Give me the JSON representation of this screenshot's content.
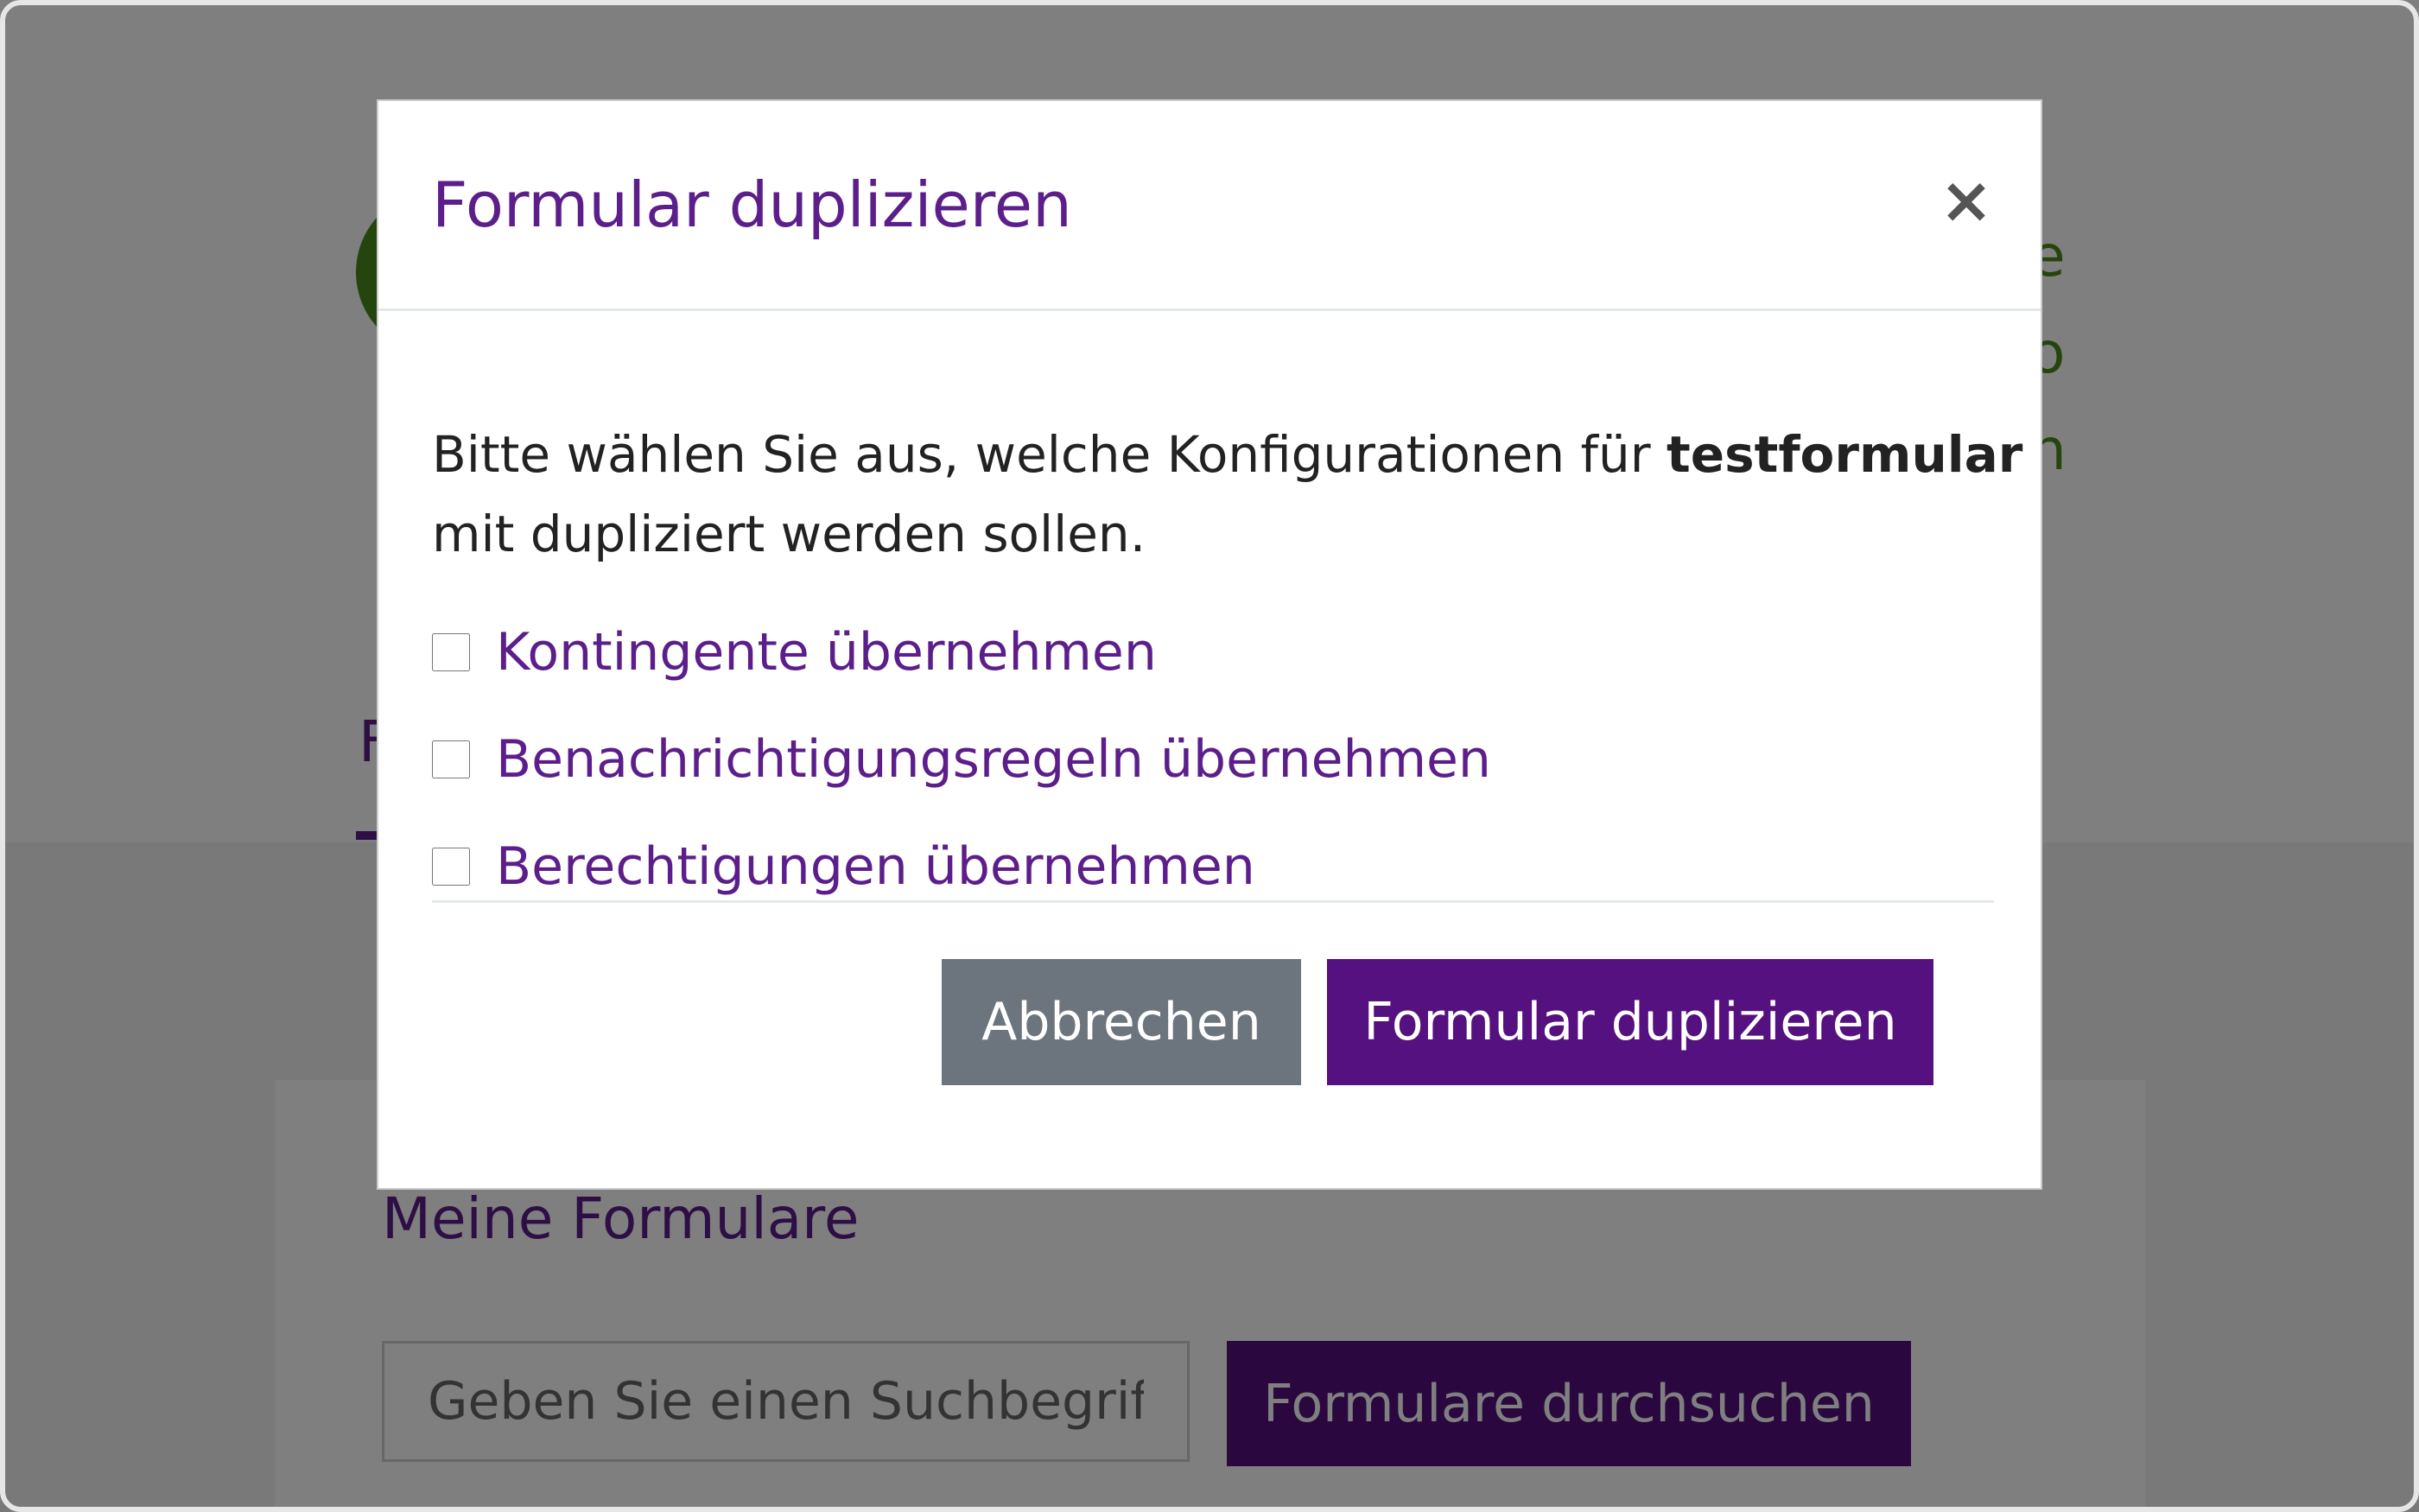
{
  "background": {
    "side_text": [
      "e",
      "o",
      "n"
    ],
    "tab_letter": "F",
    "section_title": "Meine Formulare",
    "search": {
      "placeholder": "Geben Sie einen Suchbegriff ein",
      "button_label": "Formulare durchsuchen"
    }
  },
  "modal": {
    "title": "Formular duplizieren",
    "close_symbol": "×",
    "intro_prefix": "Bitte wählen Sie aus, welche Konfigurationen für ",
    "form_name": "testformular",
    "intro_suffix": "mit dupliziert werden sollen.",
    "options": [
      {
        "label": "Kontingente übernehmen",
        "checked": false
      },
      {
        "label": "Benachrichtigungsregeln übernehmen",
        "checked": false
      },
      {
        "label": "Berechtigungen übernehmen",
        "checked": false
      }
    ],
    "cancel_label": "Abbrechen",
    "confirm_label": "Formular duplizieren"
  },
  "colors": {
    "brand_purple": "#5c1e8a",
    "button_purple": "#55117f",
    "cancel_gray": "#6c757d",
    "logo_green": "#4a8a1e"
  }
}
